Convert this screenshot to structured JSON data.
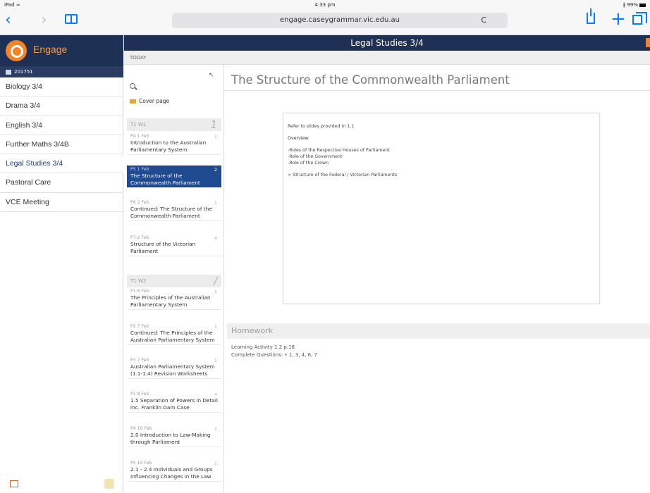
{
  "statusbar": {
    "carrier": "iPad ≈",
    "time": "4:33 pm",
    "battery": "∦ 99%"
  },
  "safari": {
    "url": "engage.caseygrammar.vic.edu.au",
    "reload": "C",
    "back": "‹",
    "forward": "›",
    "plus": "+"
  },
  "sidebar": {
    "brand": "Engage",
    "term": "201751",
    "items": [
      {
        "label": "Biology 3/4"
      },
      {
        "label": "Drama 3/4"
      },
      {
        "label": "English 3/4"
      },
      {
        "label": "Further Maths 3/4B"
      },
      {
        "label": "Legal Studies 3/4"
      },
      {
        "label": "Pastoral Care"
      },
      {
        "label": "VCE Meeting"
      }
    ]
  },
  "header": {
    "title": "Legal Studies 3/4",
    "today": "TODAY"
  },
  "lessons": {
    "cover": "Cover page",
    "weeks": [
      {
        "label": "T1 W1",
        "num": "1"
      },
      {
        "label": "T1 W2",
        "num": "/"
      }
    ],
    "items": [
      {
        "meta": "P4  1 Feb",
        "count": "1",
        "title": "Introduction to the Australian Parliamentary System"
      },
      {
        "meta": "P5  1 Feb",
        "count": "2",
        "title": "The Structure of the Commonwealth Parliament"
      },
      {
        "meta": "P6  2 Feb",
        "count": "1",
        "title": "Continued: The Structure of the Commonwealth Parliament"
      },
      {
        "meta": "P7  2 Feb",
        "count": "4",
        "title": "Structure of the Victorian Parliament"
      },
      {
        "meta": "P1  6 Feb",
        "count": "1",
        "title": "The Principles of the Australian Parliamentary System"
      },
      {
        "meta": "P2  7 Feb",
        "count": "1",
        "title": "Continued: The Principles of the Australian Parliamentary System"
      },
      {
        "meta": "P3  7 Feb",
        "count": "1",
        "title": "Australian Parliamentary System (1.1-1.4) Revision Worksheets"
      },
      {
        "meta": "P1  8 Feb",
        "count": "4",
        "title": "1.5 Separation of Powers in Detail inc. Franklin Dam Case"
      },
      {
        "meta": "P4  10 Feb",
        "count": "1",
        "title": "2.0 Introduction to Law-Making through Parliament"
      },
      {
        "meta": "P5  10 Feb",
        "count": "1",
        "title": "2.1 - 2.4 Individuals and Groups Influencing Changes in the Law"
      }
    ]
  },
  "main": {
    "title": "The Structure of the Commonwealth Parliament",
    "note": {
      "ref": "Refer to slides provided in 1.1",
      "overview": "Overview",
      "lines": [
        "-Roles of the Respective Houses of Parliament",
        "-Role of the Government",
        "-Role of the Crown"
      ],
      "structure": "> Structure of the Federal / Victorian Parliaments"
    },
    "homework": {
      "heading": "Homework",
      "line1": "Learning Activity 1.2 p.18",
      "line2": "Complete Questions: • 1, 3, 4, 6, 7"
    }
  }
}
